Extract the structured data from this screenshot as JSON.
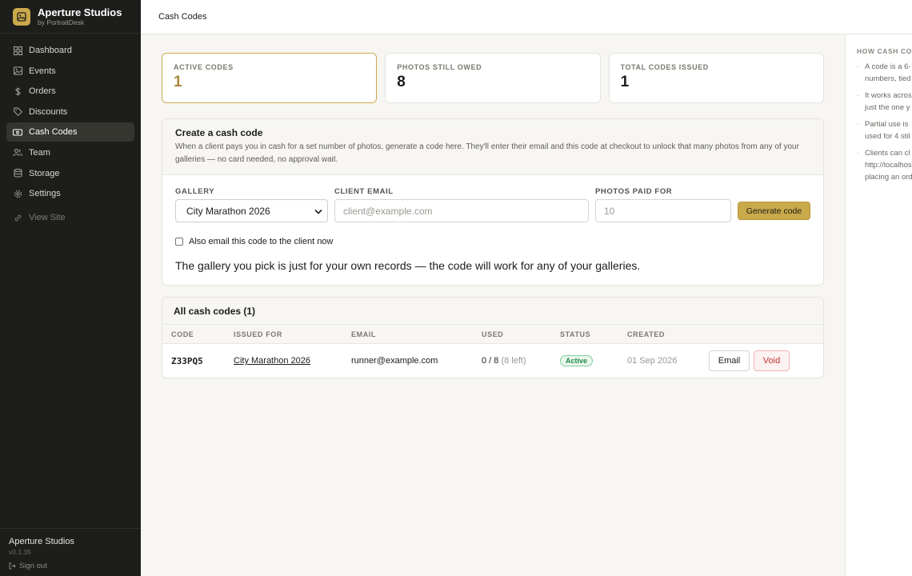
{
  "brand": {
    "name": "Aperture Studios",
    "subtitle": "by PortraitDesk"
  },
  "nav": {
    "items": [
      {
        "label": "Dashboard",
        "icon": "grid-icon"
      },
      {
        "label": "Events",
        "icon": "image-icon"
      },
      {
        "label": "Orders",
        "icon": "dollar-icon"
      },
      {
        "label": "Discounts",
        "icon": "tag-icon"
      },
      {
        "label": "Cash Codes",
        "icon": "ticket-icon",
        "active": true
      },
      {
        "label": "Team",
        "icon": "users-icon"
      },
      {
        "label": "Storage",
        "icon": "database-icon"
      },
      {
        "label": "Settings",
        "icon": "gear-icon"
      }
    ],
    "view_site": "View Site"
  },
  "footer": {
    "studio": "Aperture Studios",
    "version": "v0.1.35",
    "signout": "Sign out"
  },
  "topbar": {
    "title": "Cash Codes"
  },
  "stats": [
    {
      "label": "ACTIVE CODES",
      "value": "1"
    },
    {
      "label": "PHOTOS STILL OWED",
      "value": "8"
    },
    {
      "label": "TOTAL CODES ISSUED",
      "value": "1"
    }
  ],
  "create": {
    "title": "Create a cash code",
    "description": "When a client pays you in cash for a set number of photos, generate a code here. They'll enter their email and this code at checkout to unlock that many photos from any of your galleries — no card needed, no approval wait.",
    "gallery_label": "GALLERY",
    "gallery_value": "City Marathon 2026",
    "email_label": "CLIENT EMAIL",
    "email_placeholder": "client@example.com",
    "photos_label": "PHOTOS PAID FOR",
    "photos_placeholder": "10",
    "generate_button": "Generate code",
    "checkbox_label": "Also email this code to the client now",
    "note": "The gallery you pick is just for your own records — the code will work for any of your galleries."
  },
  "table": {
    "title": "All cash codes (1)",
    "headers": [
      "CODE",
      "ISSUED FOR",
      "EMAIL",
      "USED",
      "STATUS",
      "CREATED"
    ],
    "rows": [
      {
        "code": "Z33PQ5",
        "issued_for": "City Marathon 2026",
        "email": "runner@example.com",
        "used": "0 / 8",
        "left": "(8 left)",
        "status": "Active",
        "created": "01 Sep 2026",
        "email_button": "Email",
        "void_button": "Void"
      }
    ]
  },
  "help": {
    "title": "HOW CASH CO",
    "items": [
      [
        "A code is a 6-",
        "numbers, tied"
      ],
      [
        "It works acros",
        "just the one y"
      ],
      [
        "Partial use is",
        "used for 4 stil"
      ],
      [
        "Clients can cl",
        "http://localhos",
        "placing an ord"
      ]
    ]
  },
  "colors": {
    "accent": "#c9a94a",
    "sidebar": "#1d1d1b",
    "active_badge": "#1f8a43",
    "void": "#c53030"
  }
}
